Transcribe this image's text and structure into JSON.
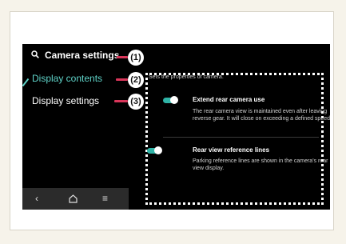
{
  "header": {
    "title": "Camera settings",
    "search_icon": "search-icon"
  },
  "menu": [
    {
      "label": "Display contents",
      "active": true
    },
    {
      "label": "Display settings",
      "active": false
    }
  ],
  "callouts": [
    "(1)",
    "(2)",
    "(3)"
  ],
  "content": {
    "description": "Sets the properties of camera.",
    "options": [
      {
        "title": "Extend rear camera use",
        "description": "The rear camera view is maintained even after leaving reverse gear. It will close on exceeding a defined speed.",
        "enabled": true
      },
      {
        "title": "Rear view reference lines",
        "description": "Parking reference lines are shown in the camera's rear view display.",
        "enabled": true
      }
    ]
  },
  "navbar": {
    "icons": [
      "back-icon",
      "home-icon",
      "menu-icon"
    ]
  },
  "colors": {
    "accent": "#2fb3a6",
    "active_text": "#5fd3c8",
    "callout_line": "#d9365a",
    "screen_bg": "#000000"
  }
}
